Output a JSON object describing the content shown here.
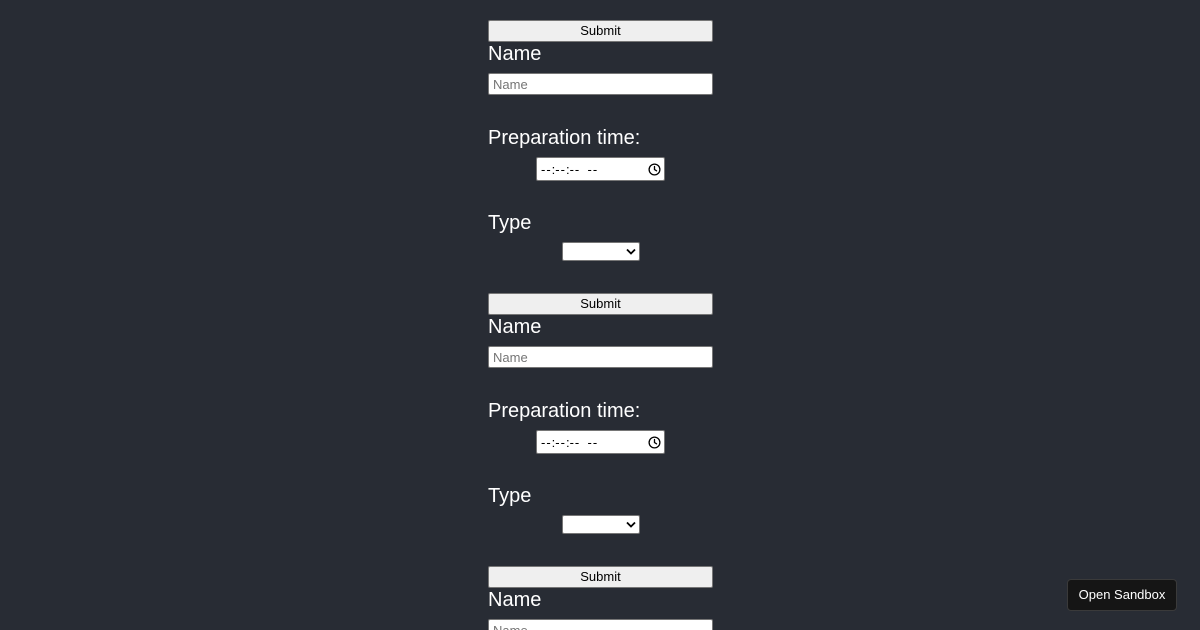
{
  "forms": [
    {
      "submit_label": "Submit",
      "name_label": "Name",
      "name_placeholder": "Name",
      "time_label": "Preparation time:",
      "time_hours": "--",
      "time_minutes": "--",
      "time_seconds": "--",
      "time_period": "--",
      "type_label": "Type",
      "type_selected": ""
    },
    {
      "submit_label": "Submit",
      "name_label": "Name",
      "name_placeholder": "Name",
      "time_label": "Preparation time:",
      "time_hours": "--",
      "time_minutes": "--",
      "time_seconds": "--",
      "time_period": "--",
      "type_label": "Type",
      "type_selected": ""
    },
    {
      "submit_label": "Submit",
      "name_label": "Name",
      "name_placeholder": "Name"
    }
  ],
  "sandbox": {
    "label": "Open Sandbox"
  },
  "colors": {
    "background": "#282c34",
    "text": "#ffffff",
    "button_bg": "#efefef"
  },
  "icons": {
    "time": "clock-icon",
    "select": "chevron-down-icon"
  }
}
